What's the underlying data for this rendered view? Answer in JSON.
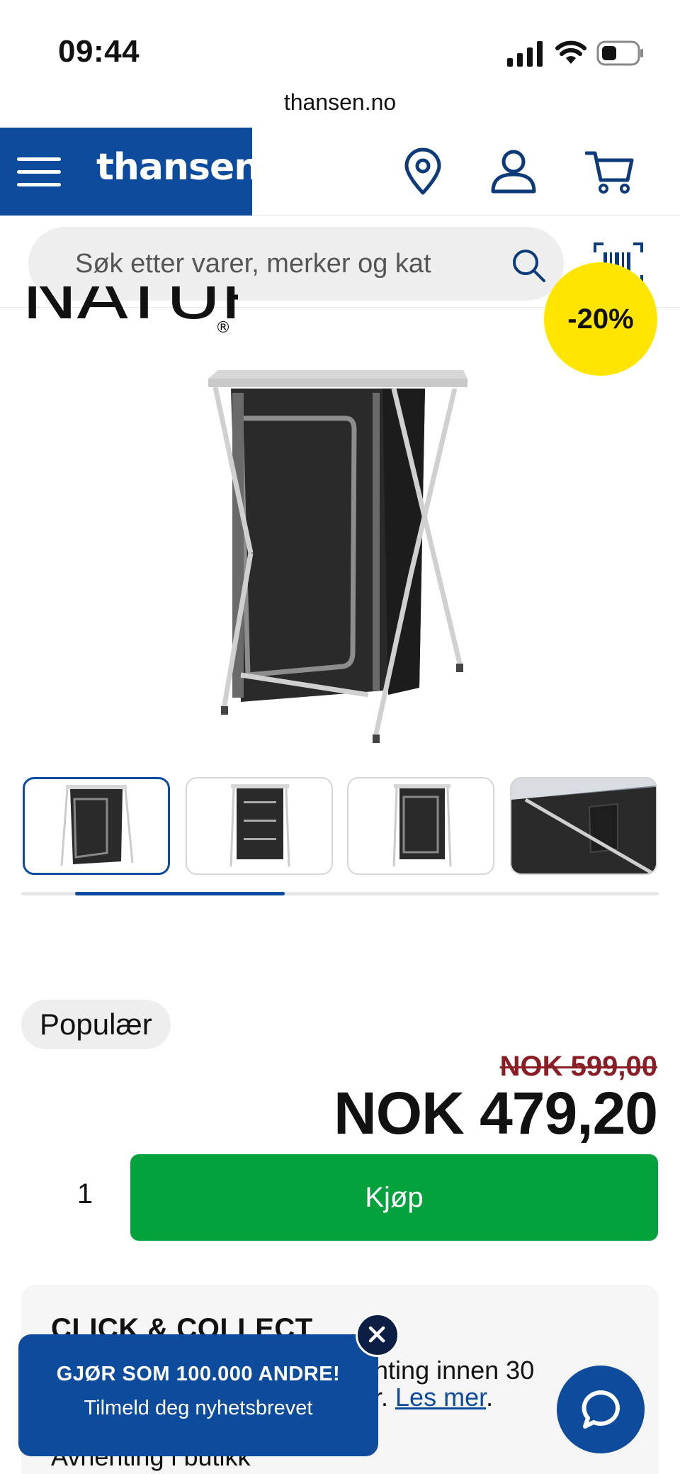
{
  "status_bar": {
    "time": "09:44"
  },
  "browser": {
    "url": "thansen.no"
  },
  "header": {
    "logo": "thansen"
  },
  "search": {
    "placeholder": "Søk etter varer, merker og kat"
  },
  "product": {
    "brand": "NATURE",
    "brand_mark": "®",
    "discount": "-20%",
    "badge": "Populær",
    "old_price": "NOK 599,00",
    "price": "NOK 479,20",
    "quantity": "1",
    "buy_label": "Kjøp",
    "thumbnail_count": 4,
    "gallery_position": 0.25
  },
  "click_collect": {
    "title": "CLICK & COLLECT",
    "text_part1": "enting innen 30",
    "text_part2": "er. ",
    "link": "Les mer",
    "text_end": ".",
    "pickup": "Avhenting i butikk"
  },
  "newsletter": {
    "heading": "GJØR SOM 100.000 ANDRE!",
    "subtext": "Tilmeld deg nyhetsbrevet"
  },
  "colors": {
    "brand_blue": "#0d4b9c",
    "buy_green": "#03a23d",
    "badge_yellow": "#ffe500",
    "old_price_red": "#8b1e24"
  },
  "icons": [
    "menu-icon",
    "location-icon",
    "user-icon",
    "cart-icon",
    "search-icon",
    "barcode-icon",
    "close-icon",
    "chat-icon"
  ]
}
